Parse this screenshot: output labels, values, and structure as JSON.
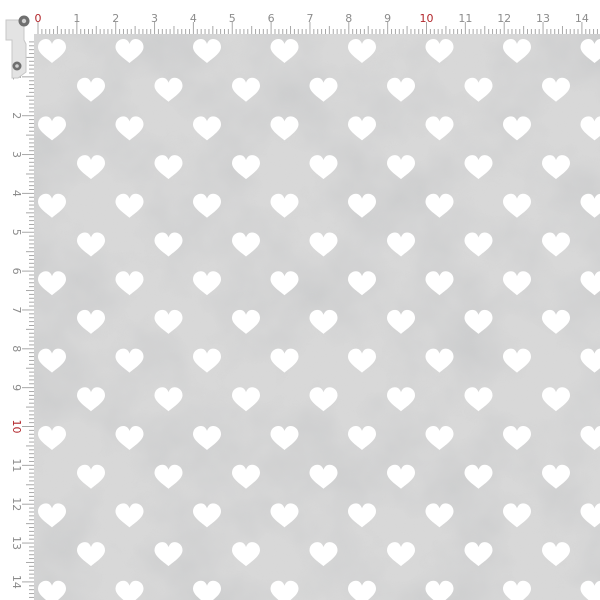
{
  "ruler": {
    "top_labels": [
      "0",
      "1",
      "2",
      "3",
      "4",
      "5",
      "6",
      "7",
      "8",
      "9",
      "10",
      "11",
      "12",
      "13",
      "14"
    ],
    "left_labels": [
      "1",
      "2",
      "3",
      "4",
      "5",
      "6",
      "7",
      "8",
      "9",
      "10",
      "11",
      "12",
      "13",
      "14"
    ],
    "label_color": "#8c8c8c",
    "highlight_color": "#b2262b",
    "highlight_labels": [
      "0",
      "10"
    ]
  },
  "pattern": {
    "background_color": "#d9d9d9",
    "heart_color": "#ffffff",
    "icon": "heart-icon",
    "rows": 15,
    "hearts_per_row": 7
  }
}
